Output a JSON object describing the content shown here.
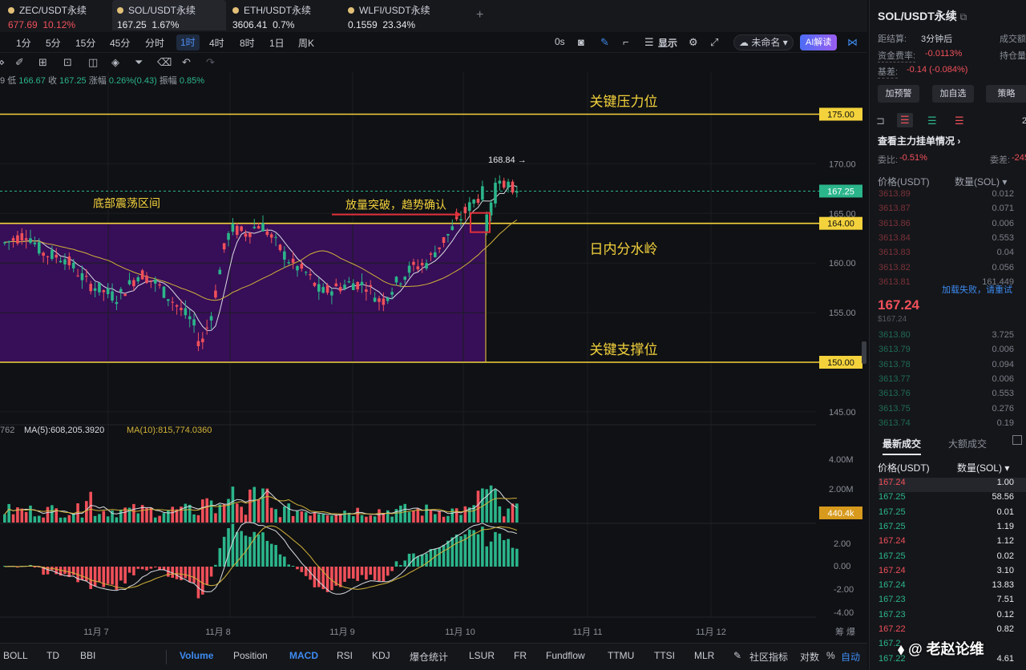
{
  "tabs": [
    {
      "name": "ZEC/USDT永续",
      "price": "677.69",
      "change": "10.12%",
      "dir": "dn",
      "dot": "#e2c077"
    },
    {
      "name": "SOL/USDT永续",
      "price": "167.25",
      "change": "1.67%",
      "dir": "up",
      "dot": "#e2c077"
    },
    {
      "name": "ETH/USDT永续",
      "price": "3606.41",
      "change": "0.7%",
      "dir": "up",
      "dot": "#e2c077"
    },
    {
      "name": "WLFI/USDT永续",
      "price": "0.1559",
      "change": "23.34%",
      "dir": "up",
      "dot": "#e2c077"
    }
  ],
  "intervals": [
    "1分",
    "5分",
    "15分",
    "45分",
    "分时",
    "1时",
    "4时",
    "8时",
    "1日",
    "周K"
  ],
  "active_interval": "1时",
  "toolbar": {
    "zero_s": "0s",
    "display": "显示",
    "unnamed": "未命名",
    "ai": "AI解读"
  },
  "ohlc": {
    "prefix": "9",
    "low_label": "低",
    "low": "166.67",
    "close_label": "收",
    "close": "167.25",
    "amp_label": "涨幅",
    "amp": "0.26%(0.43)",
    "swing_label": "振幅",
    "swing": "0.85%"
  },
  "annotations": {
    "resistance": "关键压力位",
    "box": "底部震荡区间",
    "breakout": "放量突破，趋势确认",
    "pivot": "日内分水岭",
    "support": "关键支撑位",
    "peak": "168.84"
  },
  "price_axis": {
    "ticks": [
      "170.00",
      "165.00",
      "160.00",
      "155.00",
      "150.00",
      "145.00"
    ],
    "badges": {
      "resistance": "175.00",
      "last": "167.25",
      "pivot": "164.00",
      "support": "150.00"
    }
  },
  "volume": {
    "legend_prefix": "762",
    "ma5": "MA(5):608,205.3920",
    "ma10": "MA(10):815,774.0360",
    "ticks": [
      "4.00M",
      "2.00M"
    ],
    "badge": "440.4k"
  },
  "macd": {
    "ticks": [
      "2.00",
      "0.00",
      "-2.00",
      "-4.00"
    ]
  },
  "time_axis": [
    "11月 7",
    "11月 8",
    "11月 9",
    "11月 10",
    "11月 11",
    "11月 12"
  ],
  "time_axis_right": "筹 爆",
  "bottom_tabs": [
    "BOLL",
    "TD",
    "BBI",
    "Volume",
    "Position",
    "MACD",
    "RSI",
    "KDJ",
    "爆仓统计",
    "LSUR",
    "FR",
    "Fundflow",
    "TTMU",
    "TTSI",
    "MLR"
  ],
  "bottom_active": [
    "Volume",
    "MACD"
  ],
  "bottom_right": {
    "community": "社区指标",
    "log": "对数",
    "percent": "%",
    "auto": "自动"
  },
  "right": {
    "symbol": "SOL/USDT永续",
    "settle_label": "距结算:",
    "settle": "3分钟后",
    "volume_label": "成交额",
    "funding_label": "资金费率:",
    "funding": "-0.0113%",
    "oi_label": "持仓量",
    "basis_label": "基差:",
    "basis": "-0.14 (-0.084%)",
    "buttons": [
      "加预警",
      "加自选",
      "策略"
    ],
    "depth_link": "查看主力挂单情况",
    "ratio_label": "委比:",
    "ratio": "-0.51%",
    "diff_label": "委差:",
    "diff": "-245",
    "ob_head": [
      "价格(USDT)",
      "数量(SOL)"
    ],
    "asks": [
      [
        "3613.89",
        "0.012"
      ],
      [
        "3613.87",
        "0.071"
      ],
      [
        "3613.86",
        "0.006"
      ],
      [
        "3613.84",
        "0.553"
      ],
      [
        "3613.83",
        "0.04"
      ],
      [
        "3613.82",
        "0.056"
      ],
      [
        "3613.81",
        "161.449"
      ]
    ],
    "load_fail": "加载失败，请重试",
    "mid_price": "167.24",
    "mid_sub": "$167.24",
    "bids": [
      [
        "3613.80",
        "3.725"
      ],
      [
        "3613.79",
        "0.006"
      ],
      [
        "3613.78",
        "0.094"
      ],
      [
        "3613.77",
        "0.006"
      ],
      [
        "3613.76",
        "0.553"
      ],
      [
        "3613.75",
        "0.276"
      ],
      [
        "3613.74",
        "0.19"
      ]
    ],
    "trade_tabs": [
      "最新成交",
      "大额成交"
    ],
    "trade_head": [
      "价格(USDT)",
      "数量(SOL)"
    ],
    "trades": [
      [
        "167.24",
        "1.00",
        "dn"
      ],
      [
        "167.25",
        "58.56",
        "up"
      ],
      [
        "167.25",
        "0.01",
        "up"
      ],
      [
        "167.25",
        "1.19",
        "up"
      ],
      [
        "167.24",
        "1.12",
        "dn"
      ],
      [
        "167.25",
        "0.02",
        "up"
      ],
      [
        "167.24",
        "3.10",
        "dn"
      ],
      [
        "167.24",
        "13.83",
        "up"
      ],
      [
        "167.23",
        "7.51",
        "up"
      ],
      [
        "167.23",
        "0.12",
        "up"
      ],
      [
        "167.22",
        "0.82",
        "dn"
      ],
      [
        "167.2",
        "",
        "up"
      ],
      [
        "167.22",
        "4.61",
        "up"
      ]
    ],
    "corner_num": "2"
  },
  "watermark": "老赵论维",
  "colors": {
    "up": "#2bb58a",
    "down": "#f0505a",
    "gold": "#f3d23c",
    "box": "#3a0f5c",
    "accent": "#3d8bf0"
  }
}
